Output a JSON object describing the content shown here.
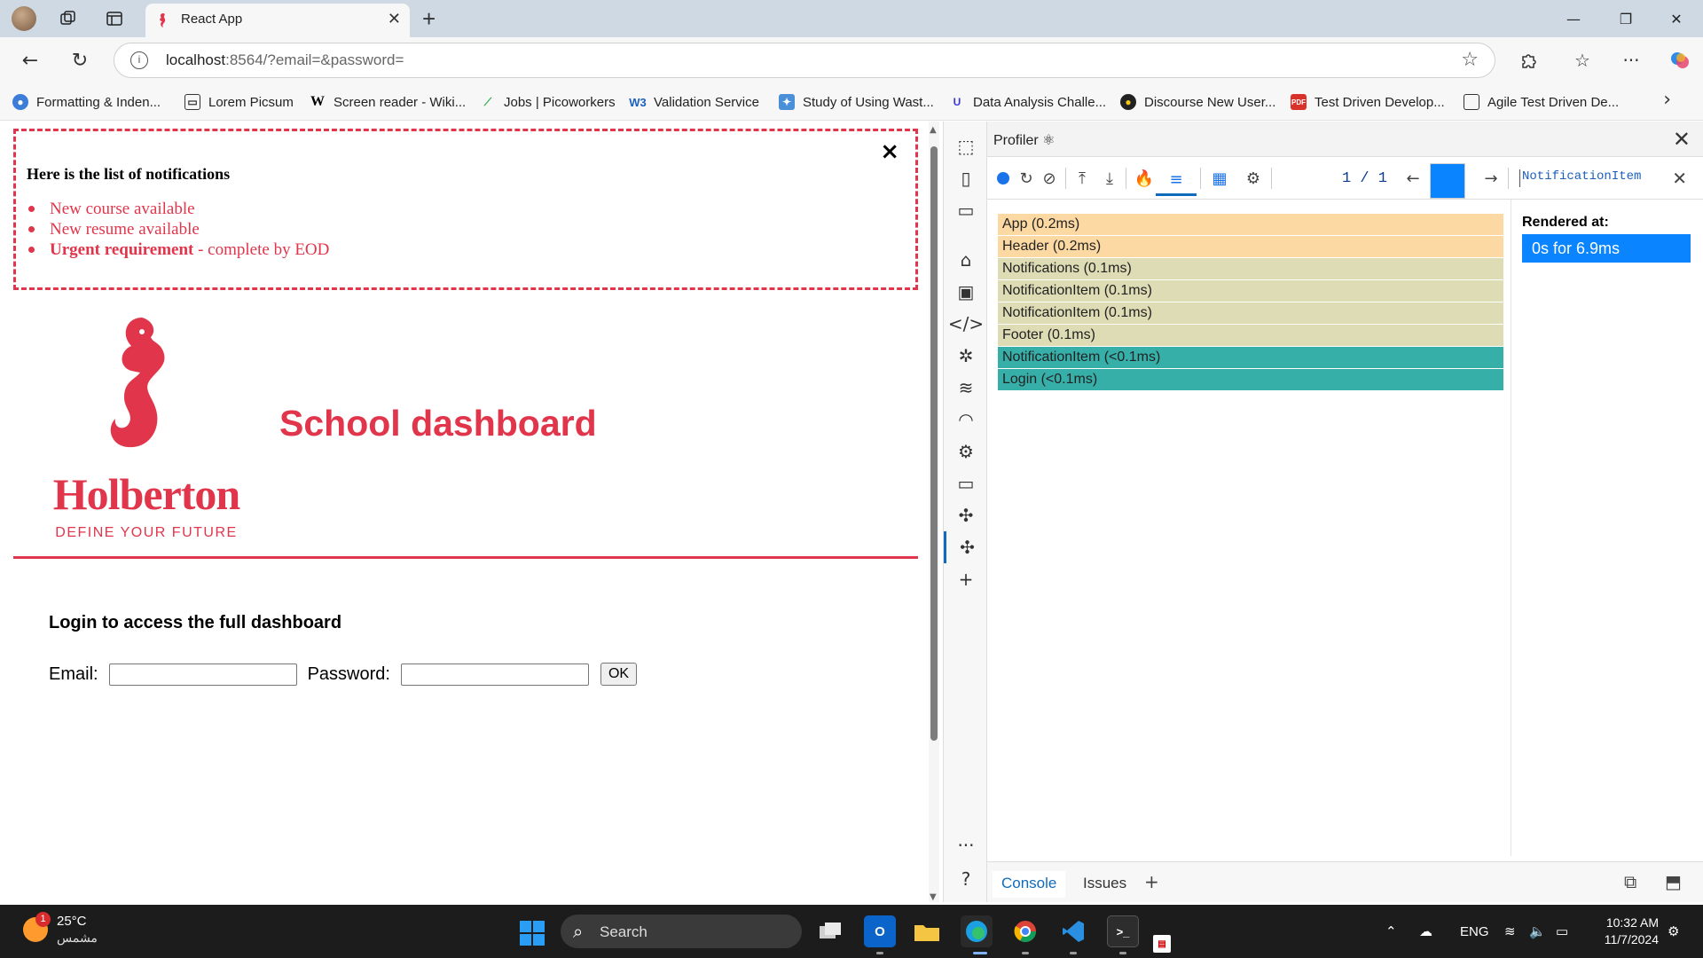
{
  "browser": {
    "tab": {
      "title": "React App",
      "close": "✕"
    },
    "new_tab": "+",
    "window_controls": {
      "minimize": "—",
      "maximize": "❐",
      "close": "✕"
    },
    "address": {
      "host": "localhost",
      "rest": ":8564/?email=&password="
    },
    "bookmarks": [
      "Formatting & Inden...",
      "Lorem Picsum",
      "Screen reader - Wiki...",
      "Jobs | Picoworkers",
      "Validation Service",
      "Study of Using Wast...",
      "Data Analysis Challe...",
      "Discourse New User...",
      "Test Driven Develop...",
      "Agile Test Driven De..."
    ]
  },
  "page": {
    "notifications": {
      "close": "×",
      "title": "Here is the list of notifications",
      "items": [
        {
          "text": "New course available"
        },
        {
          "text": "New resume available"
        },
        {
          "strong": "Urgent requirement",
          "rest": " - complete by EOD"
        }
      ]
    },
    "logo": {
      "word": "Holberton",
      "tagline": "DEFINE YOUR FUTURE"
    },
    "title": "School dashboard",
    "login": {
      "heading": "Login to access the full dashboard",
      "email_label": "Email:",
      "email_value": "",
      "password_label": "Password:",
      "password_value": "",
      "submit": "OK"
    }
  },
  "devtools": {
    "panel_title": "Profiler ⚛",
    "commit": "1 / 1",
    "search_value": "NotificationItem",
    "ranked": [
      {
        "label": "App (0.2ms)",
        "color": "#fcd9a2"
      },
      {
        "label": "Header (0.2ms)",
        "color": "#fcd9a2"
      },
      {
        "label": "Notifications (0.1ms)",
        "color": "#dedcb4"
      },
      {
        "label": "NotificationItem (0.1ms)",
        "color": "#dedcb4"
      },
      {
        "label": "NotificationItem (0.1ms)",
        "color": "#dedcb4"
      },
      {
        "label": "Footer (0.1ms)",
        "color": "#dedcb4"
      },
      {
        "label": "NotificationItem (<0.1ms)",
        "color": "#37afa9"
      },
      {
        "label": "Login (<0.1ms)",
        "color": "#37afa9"
      }
    ],
    "rendered_at_label": "Rendered at:",
    "rendered_at_value": "0s for 6.9ms",
    "drawer_tabs": [
      "Console",
      "Issues"
    ]
  },
  "taskbar": {
    "weather": {
      "badge": "1",
      "temp": "25°C",
      "condition": "مشمس"
    },
    "search_placeholder": "Search",
    "language": "ENG",
    "time": "10:32 AM",
    "date": "11/7/2024"
  },
  "colors": {
    "brand": "#e1354b",
    "accent": "#0f6cbd",
    "selection": "#0a84ff"
  }
}
